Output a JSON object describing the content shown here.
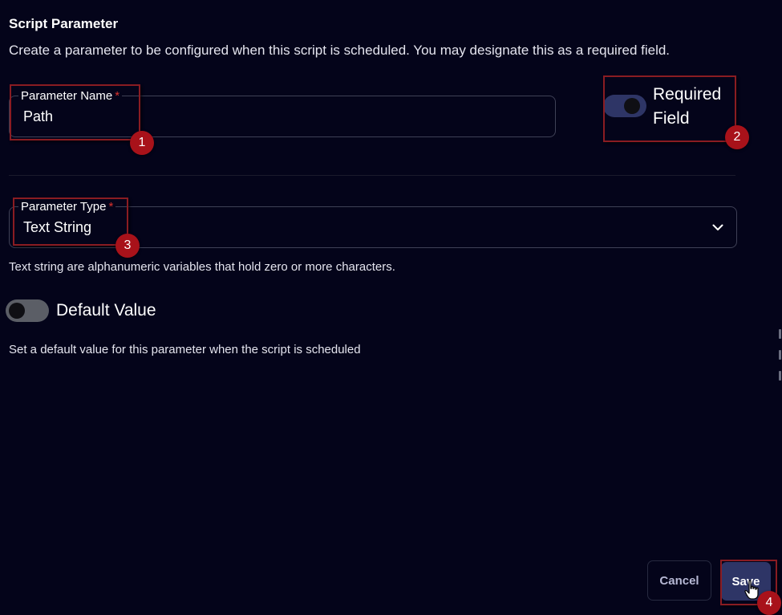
{
  "header": {
    "title": "Script Parameter",
    "subtitle": "Create a parameter to be configured when this script is scheduled. You may designate this as a required field."
  },
  "parameter_name": {
    "label": "Parameter Name",
    "required_mark": "*",
    "value": "Path"
  },
  "required_field": {
    "label": "Required Field",
    "checked": true
  },
  "parameter_type": {
    "label": "Parameter Type",
    "required_mark": "*",
    "selected": "Text String",
    "helper": "Text string are alphanumeric variables that hold zero or more characters."
  },
  "default_value": {
    "label": "Default Value",
    "checked": false,
    "helper": "Set a default value for this parameter when the script is scheduled"
  },
  "actions": {
    "cancel_label": "Cancel",
    "save_label": "Save"
  },
  "annotations": [
    "1",
    "2",
    "3",
    "4"
  ],
  "colors": {
    "background": "#04041a",
    "accent": "#2e3566",
    "annotation": "#a8121a",
    "required_star": "#d9312d"
  },
  "icons": {
    "dropdown": "chevron-down-icon",
    "cursor": "hand-pointer-icon"
  }
}
